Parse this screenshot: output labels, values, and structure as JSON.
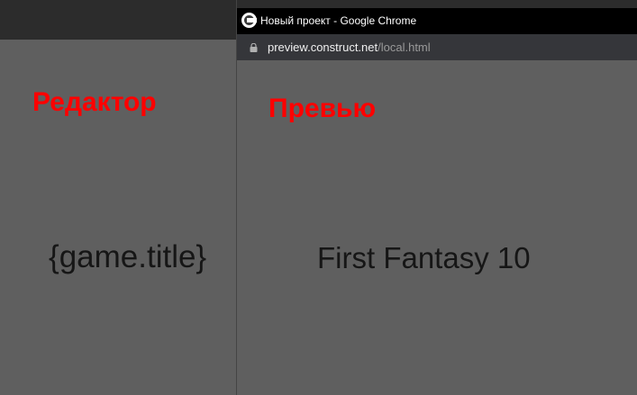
{
  "editor": {
    "heading": "Редактор",
    "expression": "{game.title}"
  },
  "chrome": {
    "window_title": "Новый проект - Google Chrome",
    "url_host": "preview.construct.net",
    "url_path": "/local.html",
    "app_icon": "construct-icon",
    "lock_icon": "lock-icon"
  },
  "preview": {
    "heading": "Превью",
    "game_title": "First Fantasy 10"
  },
  "colors": {
    "heading_red": "#ff0000",
    "canvas_gray": "#5f5f5f",
    "text_dark": "#161616"
  }
}
